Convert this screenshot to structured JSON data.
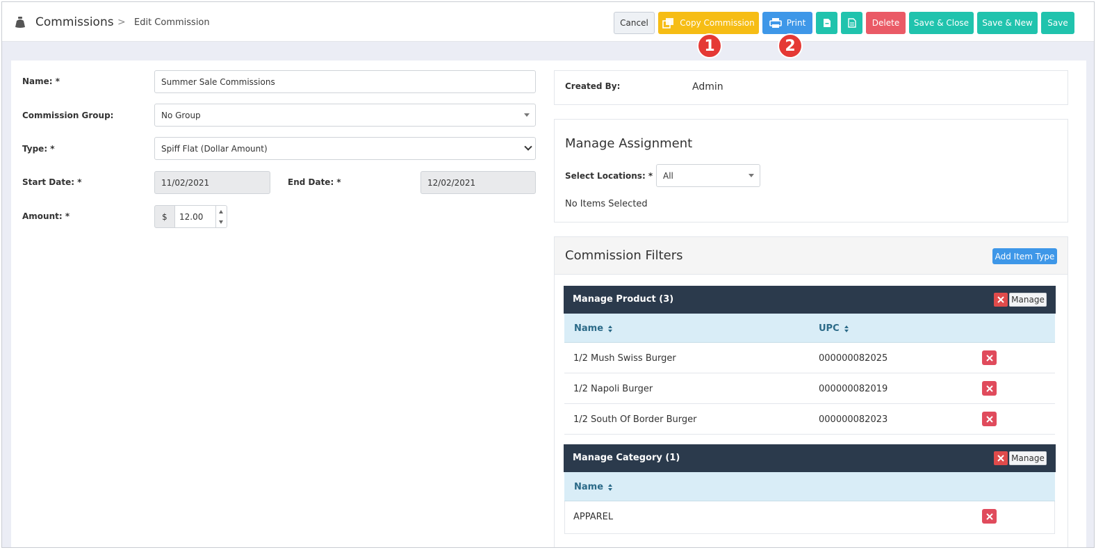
{
  "breadcrumb": {
    "title": "Commissions",
    "separator": ">",
    "current": "Edit Commission"
  },
  "toolbar": {
    "cancel": "Cancel",
    "copy": "Copy Commission",
    "print": "Print",
    "delete": "Delete",
    "save_close": "Save & Close",
    "save_new": "Save & New",
    "save": "Save"
  },
  "callouts": [
    "1",
    "2"
  ],
  "form": {
    "name_label": "Name: *",
    "name_value": "Summer Sale Commissions",
    "group_label": "Commission Group:",
    "group_value": "No Group",
    "type_label": "Type: *",
    "type_value": "Spiff Flat (Dollar Amount)",
    "start_label": "Start Date: *",
    "start_value": "11/02/2021",
    "end_label": "End Date: *",
    "end_value": "12/02/2021",
    "amount_label": "Amount: *",
    "currency": "$",
    "amount_value": "12.00"
  },
  "created": {
    "label": "Created By:",
    "value": "Admin"
  },
  "assignment": {
    "title": "Manage Assignment",
    "locations_label": "Select Locations: *",
    "locations_value": "All",
    "empty": "No Items Selected"
  },
  "filters": {
    "title": "Commission Filters",
    "add_button": "Add Item Type",
    "product": {
      "title": "Manage Product (3)",
      "manage": "Manage",
      "col_name": "Name",
      "col_upc": "UPC",
      "rows": [
        {
          "name": "1/2 Mush Swiss Burger",
          "upc": "000000082025"
        },
        {
          "name": "1/2 Napoli Burger",
          "upc": "000000082019"
        },
        {
          "name": "1/2 South Of Border Burger",
          "upc": "000000082023"
        }
      ]
    },
    "category": {
      "title": "Manage Category (1)",
      "manage": "Manage",
      "col_name": "Name",
      "rows": [
        {
          "name": "APPAREL"
        }
      ]
    }
  },
  "colors": {
    "accent_teal": "#20c3ad",
    "copy_yellow": "#f6bd15",
    "print_blue": "#3e97e8",
    "delete_red": "#ea5a66",
    "header_dark": "#2b3a4c"
  }
}
